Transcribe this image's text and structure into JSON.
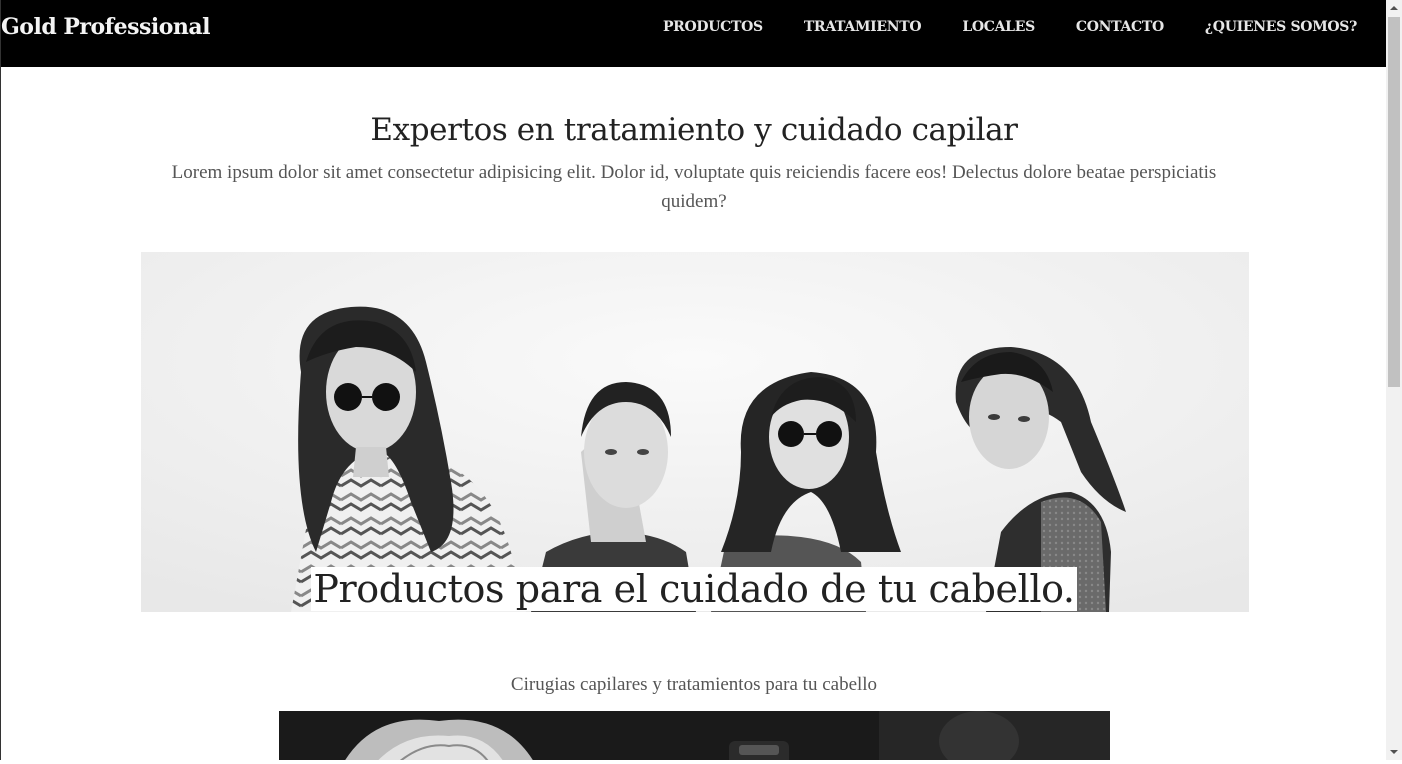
{
  "navbar": {
    "brand": "Gold Professional",
    "links": [
      "PRODUCTOS",
      "TRATAMIENTO",
      "LOCALES",
      "CONTACTO",
      "¿QUIENES SOMOS?"
    ]
  },
  "hero": {
    "title": "Expertos en tratamiento y cuidado capilar",
    "text": "Lorem ipsum dolor sit amet consectetur adipisicing elit. Dolor id, voluptate quis reiciendis facere eos! Delectus dolore beatae perspiciatis quidem?"
  },
  "section": {
    "title": "Productos para el cuidado de tu cabello.",
    "subtitle": "Cirugias capilares y tratamientos para tu cabello"
  },
  "colors": {
    "navbar_bg": "#000000",
    "page_bg": "#ffffff"
  }
}
